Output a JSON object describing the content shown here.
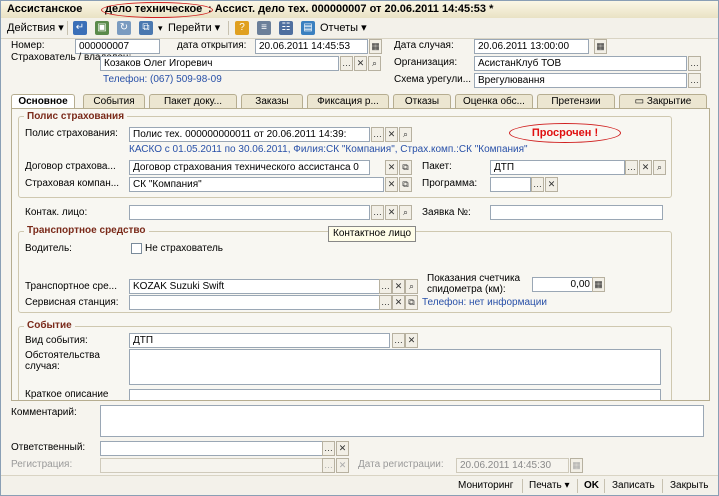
{
  "window": {
    "title_part1": "Ассистанское ",
    "title_part2": "дело техническое",
    "title_part3": ": Ассист. дело тех. 000000007 от 20.06.2011 14:45:53 *"
  },
  "toolbar": {
    "actions": "Действия ▾",
    "goto": "Перейти ▾",
    "reports": "Отчеты ▾"
  },
  "header": {
    "number_label": "Номер:",
    "number_value": "000000007",
    "open_date_label": "дата открытия:",
    "open_date_value": "20.06.2011 14:45:53",
    "case_date_label": "Дата случая:",
    "case_date_value": "20.06.2011 13:00:00",
    "insured_label": "Страхователь / владелец:",
    "insured_value": "Козаков Олег Игоревич",
    "org_label": "Организация:",
    "org_value": "АсистанКлуб ТОВ",
    "phone_link": "Телефон: (067) 509-98-09",
    "scheme_label": "Схема урегули...",
    "scheme_value": "Врегулювання"
  },
  "tabs": [
    "Основное",
    "События",
    "Пакет доку...",
    "Заказы",
    "Фиксация р...",
    "Отказы",
    "Оценка обс...",
    "Претензии",
    "Закрытие"
  ],
  "policy": {
    "group_title": "Полис страхования",
    "policy_label": "Полис страхования:",
    "policy_value": "Полис тех. 000000000011 от 20.06.2011 14:39:",
    "overdue": "Просрочен !",
    "policy_info": "КАСКО с 01.05.2011 по 30.06.2011, Филия:СК \"Компания\", Страх.комп.:СК \"Компания\"",
    "contract_label": "Договор страхова...",
    "contract_value": "Договор страхования технического ассистанса 0",
    "package_label": "Пакет:",
    "package_value": "ДТП",
    "company_label": "Страховая компан...",
    "company_value": "СК \"Компания\"",
    "program_label": "Программа:",
    "program_value": ""
  },
  "contact": {
    "label": "Контак. лицо:",
    "value": "",
    "request_label": "Заявка №:",
    "request_value": "",
    "tooltip": "Контактное лицо"
  },
  "vehicle": {
    "group_title": "Транспортное средство",
    "driver_label": "Водитель:",
    "not_insured_label": "Не страхователь",
    "vehicle_label": "Транспортное сре...",
    "vehicle_value": "KOZAK Suzuki Swift",
    "odometer_label": "Показания счетчика спидометра (км):",
    "odometer_value": "0,00",
    "service_label": "Сервисная станция:",
    "service_value": "",
    "phone_info": "Телефон: нет информации"
  },
  "event": {
    "group_title": "Событие",
    "type_label": "Вид события:",
    "type_value": "ДТП",
    "circumstances_label": "Обстоятельства случая:",
    "short_label": "Краткое описание"
  },
  "footer": {
    "comment_label": "Комментарий:",
    "responsible_label": "Ответственный:",
    "registration_label": "Регистрация:",
    "reg_date_label": "Дата регистрации:",
    "reg_date_value": "20.06.2011 14:45:30"
  },
  "statusbar": {
    "monitoring": "Мониторинг",
    "print": "Печать ▾",
    "ok": "OK",
    "save": "Записать",
    "close": "Закрыть"
  }
}
